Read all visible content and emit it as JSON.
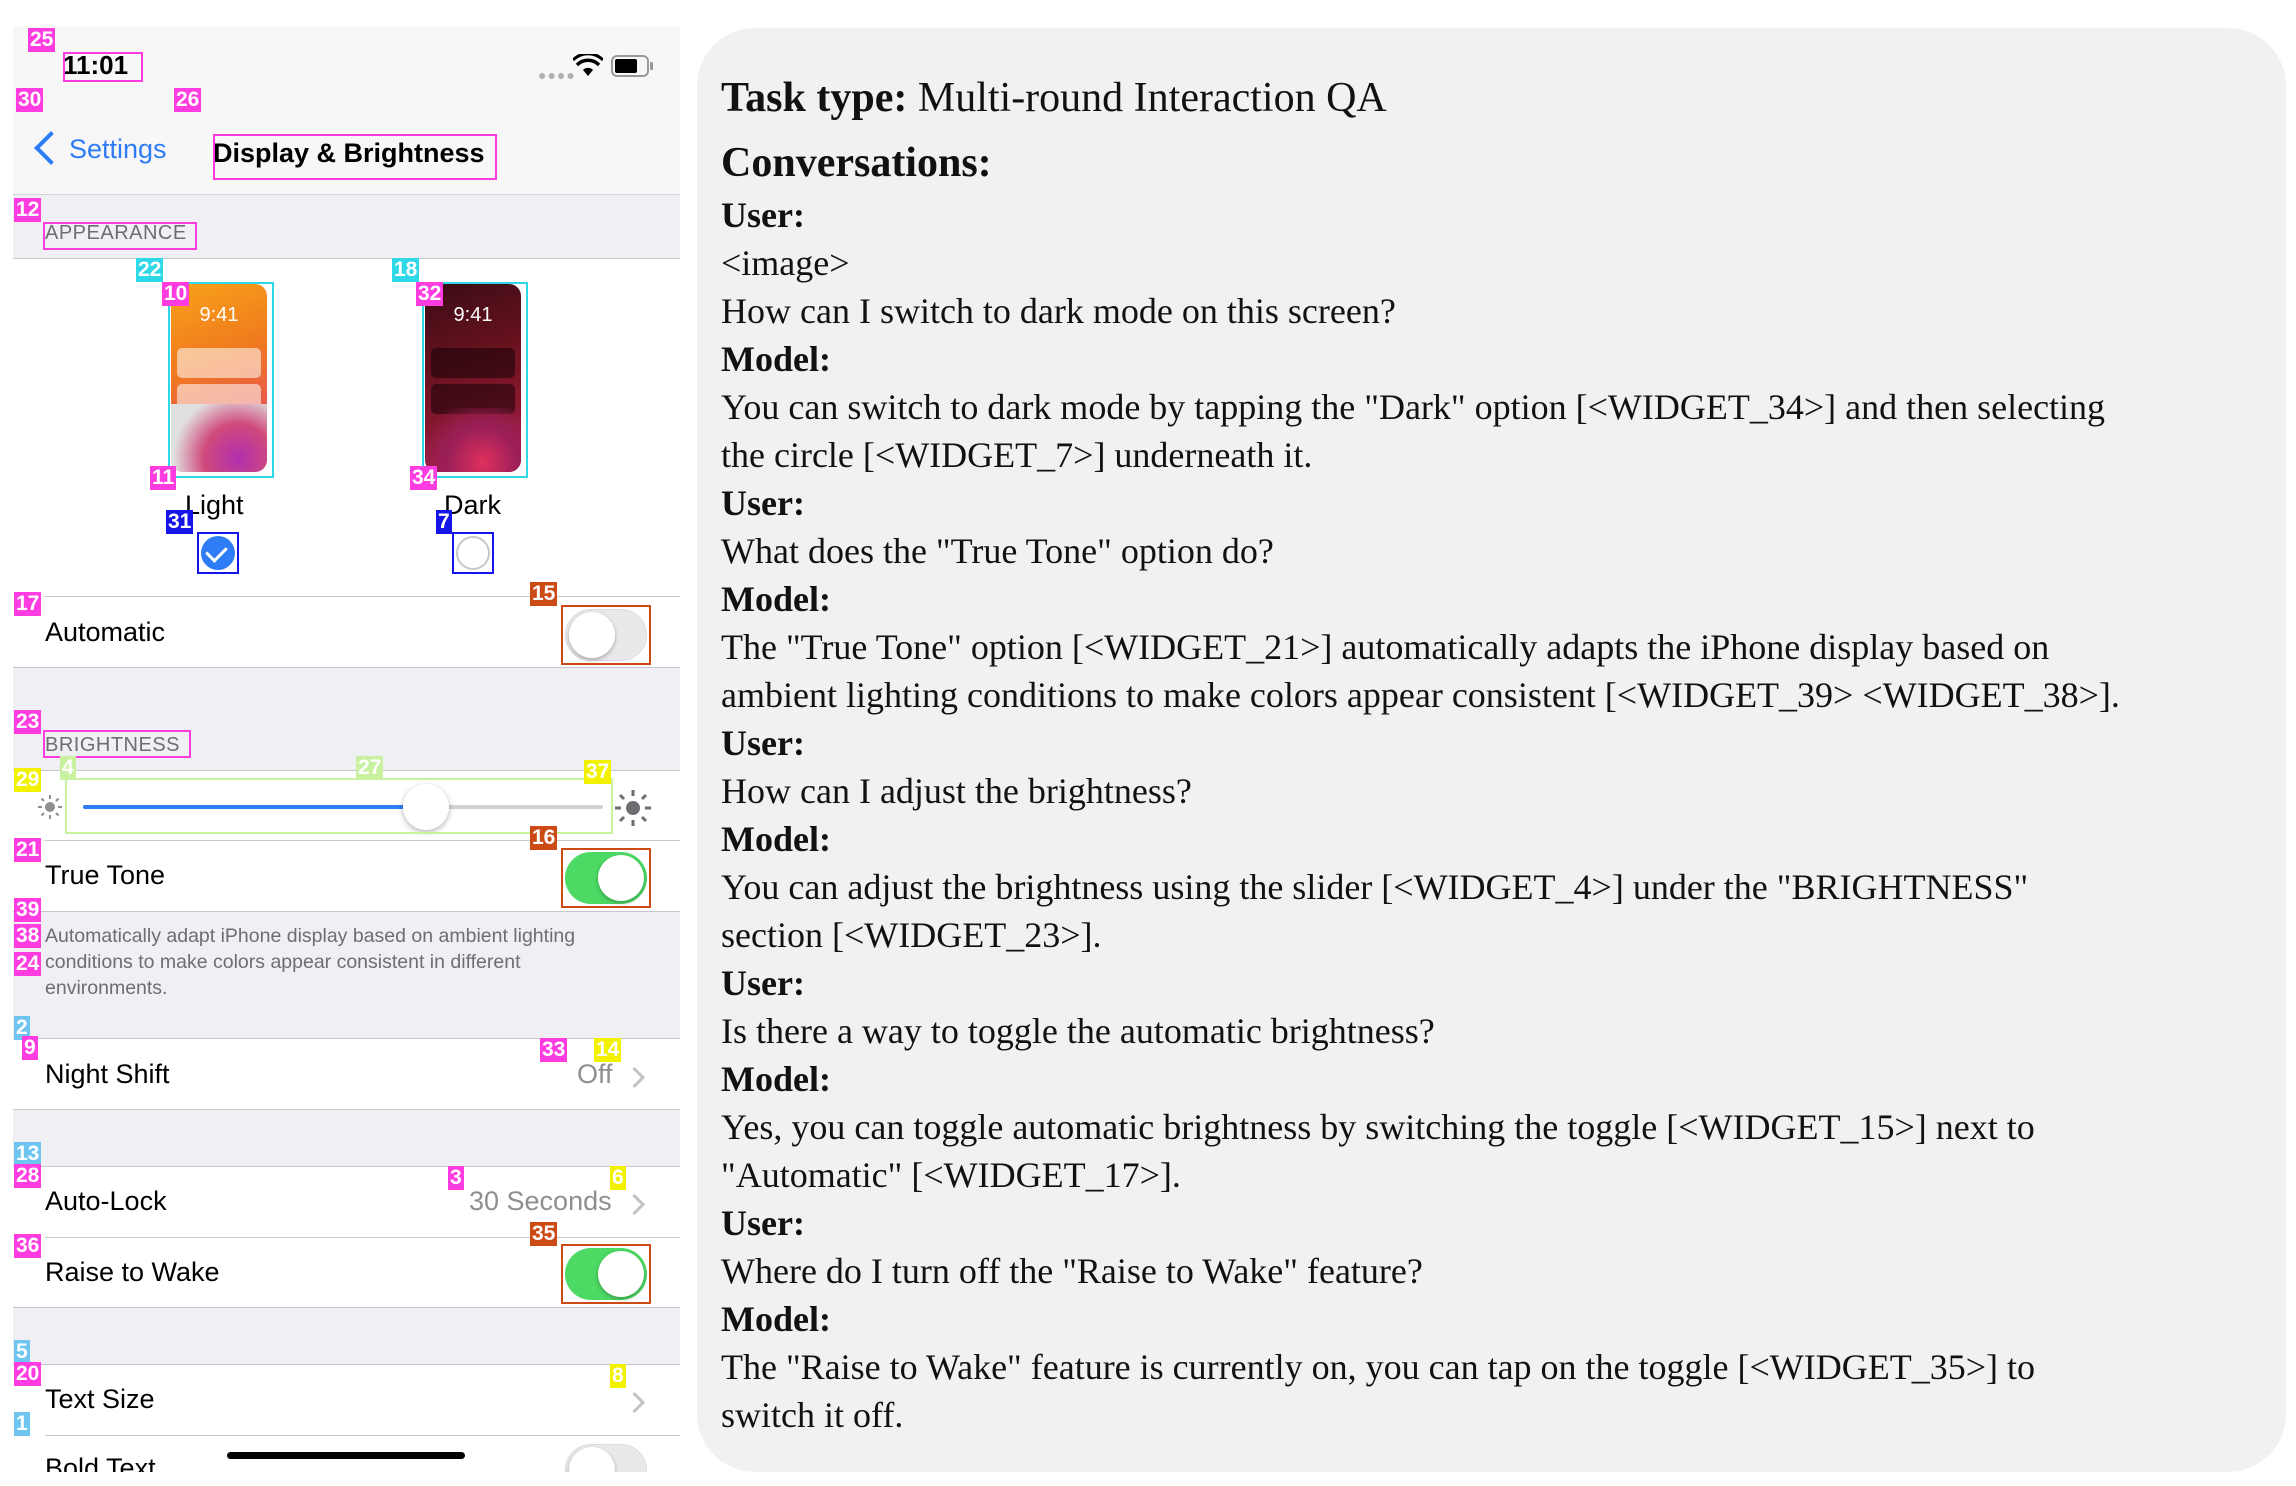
{
  "phone": {
    "status": {
      "time": "11:01"
    },
    "nav": {
      "back_label": "Settings",
      "title": "Display & Brightness"
    },
    "appearance": {
      "header": "APPEARANCE",
      "light": {
        "thumb_time": "9:41",
        "label": "Light",
        "selected": true
      },
      "dark": {
        "thumb_time": "9:41",
        "label": "Dark",
        "selected": false
      }
    },
    "automatic": {
      "label": "Automatic",
      "toggle_on": false
    },
    "brightness": {
      "header": "BRIGHTNESS",
      "level": 0.66
    },
    "true_tone": {
      "label": "True Tone",
      "toggle_on": true,
      "description_lines": [
        "Automatically adapt iPhone display based on ambient lighting",
        "conditions to make colors appear consistent in different",
        "environments."
      ]
    },
    "night_shift": {
      "label": "Night Shift",
      "value": "Off"
    },
    "auto_lock": {
      "label": "Auto-Lock",
      "value": "30 Seconds"
    },
    "raise_to_wake": {
      "label": "Raise to Wake",
      "toggle_on": true
    },
    "text_size": {
      "label": "Text Size"
    },
    "bold_text": {
      "label": "Bold Text"
    },
    "widget_tags": {
      "t25": "25",
      "t30": "30",
      "t26": "26",
      "t12": "12",
      "t22": "22",
      "t10": "10",
      "t18": "18",
      "t32": "32",
      "t11": "11",
      "t34": "34",
      "t31": "31",
      "t7": "7",
      "t17": "17",
      "t15": "15",
      "t23": "23",
      "t4": "4",
      "t27": "27",
      "t37": "37",
      "t29": "29",
      "t21": "21",
      "t16": "16",
      "t39": "39",
      "t38": "38",
      "t24": "24",
      "t2": "2",
      "t9": "9",
      "t33": "33",
      "t14": "14",
      "t13": "13",
      "t28": "28",
      "t3": "3",
      "t6": "6",
      "t36": "36",
      "t35": "35",
      "t5": "5",
      "t20": "20",
      "t8": "8",
      "t1": "1"
    },
    "tag_colors": {
      "magenta": "#ff3ce0",
      "cyan": "#2fd8e6",
      "blue": "#1515e8",
      "orange": "#cc4a14",
      "yellow": "#f2f200",
      "lightgreen": "#c8f2a0",
      "sky": "#6ec6f0"
    }
  },
  "conversation": {
    "task_label": "Task type:",
    "task_value": " Multi-round Interaction QA",
    "conversations_label": "Conversations:",
    "lines": [
      {
        "text": "User:",
        "bold": true
      },
      {
        "text": "<image>",
        "bold": false
      },
      {
        "text": "How can I switch to dark mode on this screen?",
        "bold": false
      },
      {
        "text": "Model:",
        "bold": true
      },
      {
        "text": "You can switch to dark mode by tapping the \"Dark\" option [<WIDGET_34>] and then selecting",
        "bold": false
      },
      {
        "text": "the circle [<WIDGET_7>] underneath it.",
        "bold": false
      },
      {
        "text": "User:",
        "bold": true
      },
      {
        "text": "What does the \"True Tone\" option do?",
        "bold": false
      },
      {
        "text": "Model:",
        "bold": true
      },
      {
        "text": "The \"True Tone\" option [<WIDGET_21>] automatically adapts the iPhone display based on",
        "bold": false
      },
      {
        "text": "ambient lighting conditions to make colors appear consistent [<WIDGET_39> <WIDGET_38>].",
        "bold": false
      },
      {
        "text": "User:",
        "bold": true
      },
      {
        "text": "How can I adjust the brightness?",
        "bold": false
      },
      {
        "text": "Model:",
        "bold": true
      },
      {
        "text": "You can adjust the brightness using the slider [<WIDGET_4>] under the \"BRIGHTNESS\"",
        "bold": false
      },
      {
        "text": "section [<WIDGET_23>].",
        "bold": false
      },
      {
        "text": "User:",
        "bold": true
      },
      {
        "text": "Is there a way to toggle the automatic brightness?",
        "bold": false
      },
      {
        "text": "Model:",
        "bold": true
      },
      {
        "text": "Yes, you can toggle automatic brightness by switching the toggle [<WIDGET_15>] next to",
        "bold": false
      },
      {
        "text": "\"Automatic\" [<WIDGET_17>].",
        "bold": false
      },
      {
        "text": "User:",
        "bold": true
      },
      {
        "text": "Where do I turn off the \"Raise to Wake\" feature?",
        "bold": false
      },
      {
        "text": "Model:",
        "bold": true
      },
      {
        "text": "The \"Raise to Wake\" feature is currently on, you can tap on the toggle [<WIDGET_35>] to",
        "bold": false
      },
      {
        "text": "switch it off.",
        "bold": false
      }
    ]
  }
}
